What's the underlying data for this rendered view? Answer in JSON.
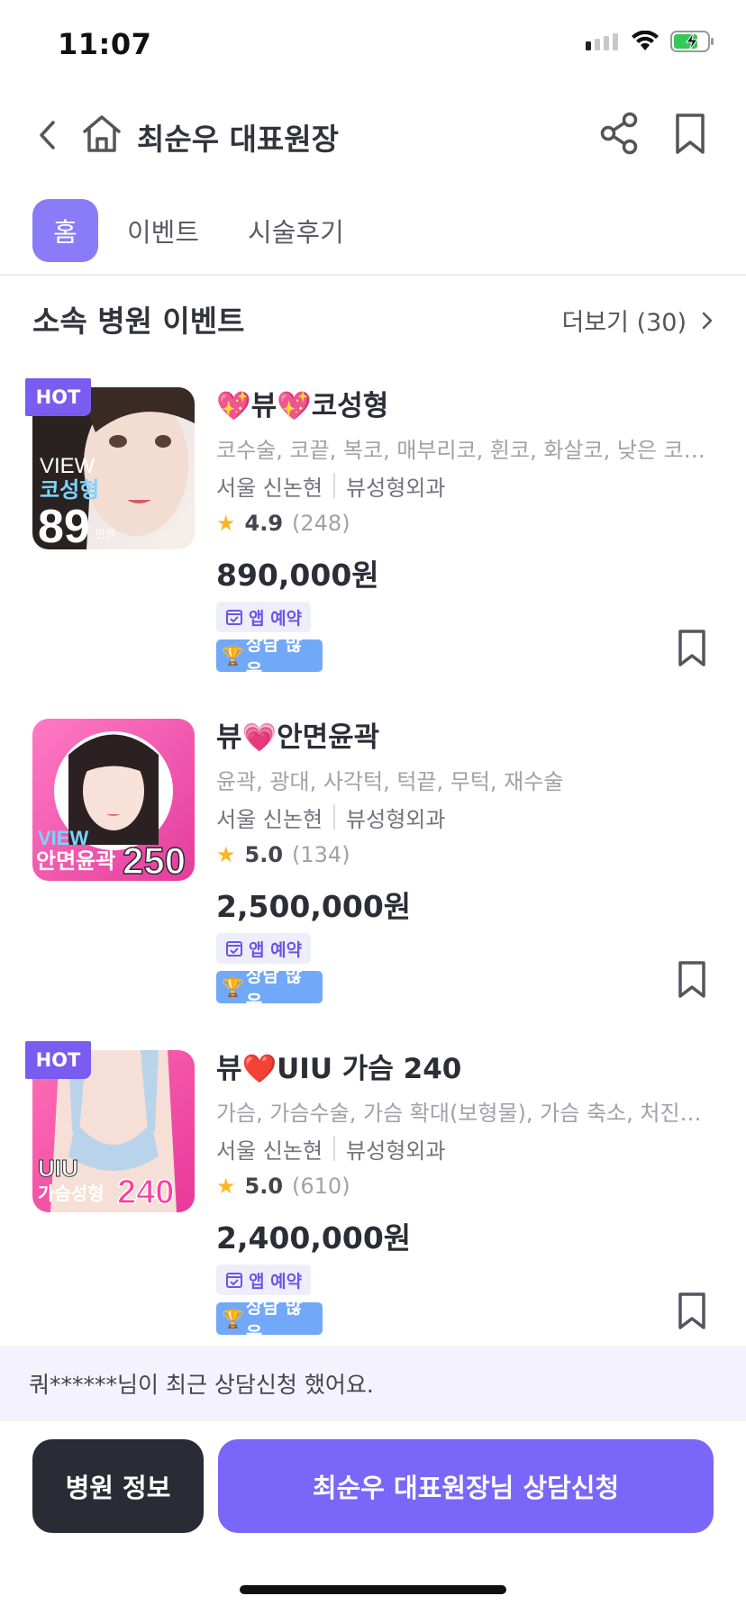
{
  "status_bar": {
    "time": "11:07"
  },
  "header": {
    "title": "최순우 대표원장"
  },
  "tabs": [
    {
      "label": "홈",
      "active": true
    },
    {
      "label": "이벤트",
      "active": false
    },
    {
      "label": "시술후기",
      "active": false
    }
  ],
  "section": {
    "title": "소속 병원 이벤트",
    "more_label": "더보기 (30)"
  },
  "events": [
    {
      "hot": "HOT",
      "title_prefix": "💖뷰💖",
      "title_main": "코성형",
      "tags": "코수술, 코끝, 복코, 매부리코, 휜코, 화살코, 낮은 코…",
      "location": "서울 신논현",
      "clinic": "뷰성형외과",
      "rating": "4.9",
      "review_count": "(248)",
      "price": "890,000원",
      "app_badge": "앱 예약",
      "consult_badge": "상담 많은",
      "thumb": {
        "line1": "VIEW",
        "line2": "코성형",
        "line3": "89",
        "unit": "만원"
      }
    },
    {
      "hot": "",
      "title_prefix": "뷰💗",
      "title_main": "안면윤곽",
      "tags": "윤곽, 광대, 사각턱, 턱끝, 무턱, 재수술",
      "location": "서울 신논현",
      "clinic": "뷰성형외과",
      "rating": "5.0",
      "review_count": "(134)",
      "price": "2,500,000원",
      "app_badge": "앱 예약",
      "consult_badge": "상담 많은",
      "thumb": {
        "line1": "VIEW",
        "line2": "안면윤곽",
        "line3": "250"
      }
    },
    {
      "hot": "HOT",
      "title_prefix": "뷰❤️",
      "title_main": "UIU 가슴 240",
      "tags": "가슴, 가슴수술, 가슴 확대(보형물), 가슴 축소, 처진…",
      "location": "서울 신논현",
      "clinic": "뷰성형외과",
      "rating": "5.0",
      "review_count": "(610)",
      "price": "2,400,000원",
      "app_badge": "앱 예약",
      "consult_badge": "상담 많은",
      "thumb": {
        "line1": "UIU",
        "line2": "가슴성형",
        "line3": "240"
      }
    }
  ],
  "notice": {
    "text": "쿼******님이 최근 상담신청 했어요."
  },
  "actions": {
    "info_label": "병원 정보",
    "consult_label": "최순우 대표원장님 상담신청"
  },
  "colors": {
    "accent": "#7a66f8",
    "tab_active": "#8a7cf8",
    "dark_button": "#2b2b36",
    "star": "#fbb624",
    "consult_badge": "#71a8f7"
  }
}
